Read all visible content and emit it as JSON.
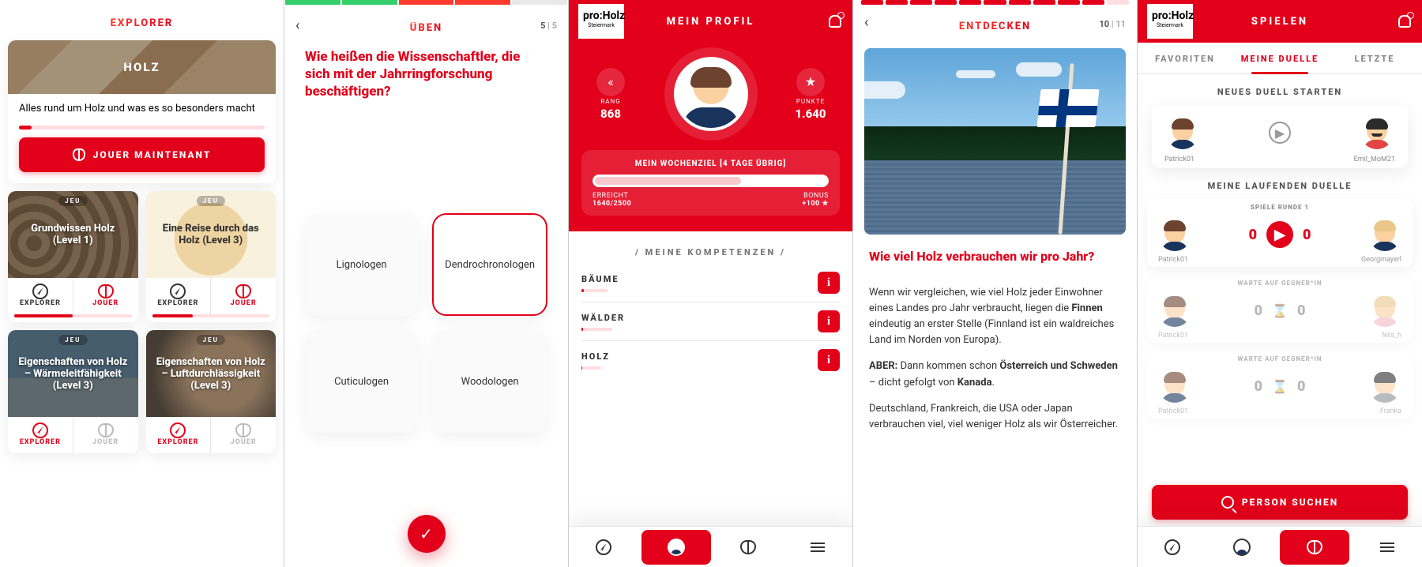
{
  "screens": {
    "explorer": {
      "title": "EXPLORER",
      "hero": {
        "badge": "HOLZ",
        "subtitle": "Alles rund um Holz und was es so besonders macht"
      },
      "play_button": "JOUER MAINTENANT",
      "card_badge": "JEU",
      "cards": [
        {
          "title": "Grundwissen Holz (Level 1)"
        },
        {
          "title": "Eine Reise durch das Holz (Level 3)"
        },
        {
          "title": "Eigenschaften von Holz – Wärmeleitfähigkeit (Level 3)"
        },
        {
          "title": "Eigenschaften von Holz – Luftdurchlässigkeit (Level 3)"
        }
      ],
      "card_actions": {
        "explore": "EXPLORER",
        "play": "JOUER"
      }
    },
    "practice": {
      "title": "ÜBEN",
      "counter": {
        "n": "5",
        "of": "5"
      },
      "question": "Wie heißen die Wissenschaftler, die sich mit der Jahrringforschung beschäftigen?",
      "options": [
        "Lignologen",
        "Dendrochronologen",
        "Cuticulogen",
        "Woodologen"
      ]
    },
    "profile": {
      "brand": {
        "name": "pro:Holz",
        "sub": "Steiermark"
      },
      "title": "MEIN PROFIL",
      "rank": {
        "label": "RANG",
        "value": "868"
      },
      "points": {
        "label": "PUNKTE",
        "value": "1.640"
      },
      "goal": {
        "title": "MEIN WOCHENZIEL [4 TAGE ÜBRIG]",
        "reached_label": "ERREICHT",
        "reached_value": "1640/2500",
        "bonus_label": "BONUS",
        "bonus_value": "+100 ★"
      },
      "competences_header": "/ MEINE KOMPETENZEN /",
      "competences": [
        "BÄUME",
        "WÄLDER",
        "HOLZ"
      ]
    },
    "discover": {
      "title": "ENTDECKEN",
      "counter": {
        "n": "10",
        "of": "11"
      },
      "headline": "Wie viel Holz verbrauchen wir pro Jahr?",
      "p1a": "Wenn wir vergleichen, wie viel Holz jeder Einwohner eines Landes pro Jahr verbraucht, liegen die ",
      "p1b": "Finnen",
      "p1c": " eindeutig an erster Stelle (Finnland ist ein waldreiches Land im Norden von Europa).",
      "p2a": "ABER:",
      "p2b": " Dann kommen schon ",
      "p2c": "Österreich und Schweden",
      "p2d": " – dicht gefolgt von ",
      "p2e": "Kanada",
      "p2f": ".",
      "p3": "Deutschland, Frankreich, die USA oder Japan verbrauchen viel, viel weniger Holz als wir Österreicher."
    },
    "play": {
      "brand": {
        "name": "pro:Holz",
        "sub": "Steiermark"
      },
      "title": "SPIELEN",
      "tabs": [
        "FAVORITEN",
        "MEINE DUELLE",
        "LETZTE"
      ],
      "new_duel_header": "NEUES DUELL STARTEN",
      "new_duel": {
        "left": "Patrick01",
        "right": "Emil_MoM21"
      },
      "running_header": "MEINE LAUFENDEN DUELLE",
      "round_label": "SPIELE RUNDE 1",
      "wait_label": "WARTE AUF GEGNER*IN",
      "duels": [
        {
          "left_user": "Patrick01",
          "right_user": "Georgmayerl",
          "score_l": "0",
          "score_r": "0",
          "state": "active"
        },
        {
          "left_user": "Patrick01",
          "right_user": "Nils_h",
          "score_l": "0",
          "score_r": "0",
          "state": "wait"
        },
        {
          "left_user": "Patrick01",
          "right_user": "Franka",
          "score_l": "0",
          "score_r": "0",
          "state": "wait"
        }
      ],
      "search_btn": "PERSON SUCHEN"
    }
  }
}
